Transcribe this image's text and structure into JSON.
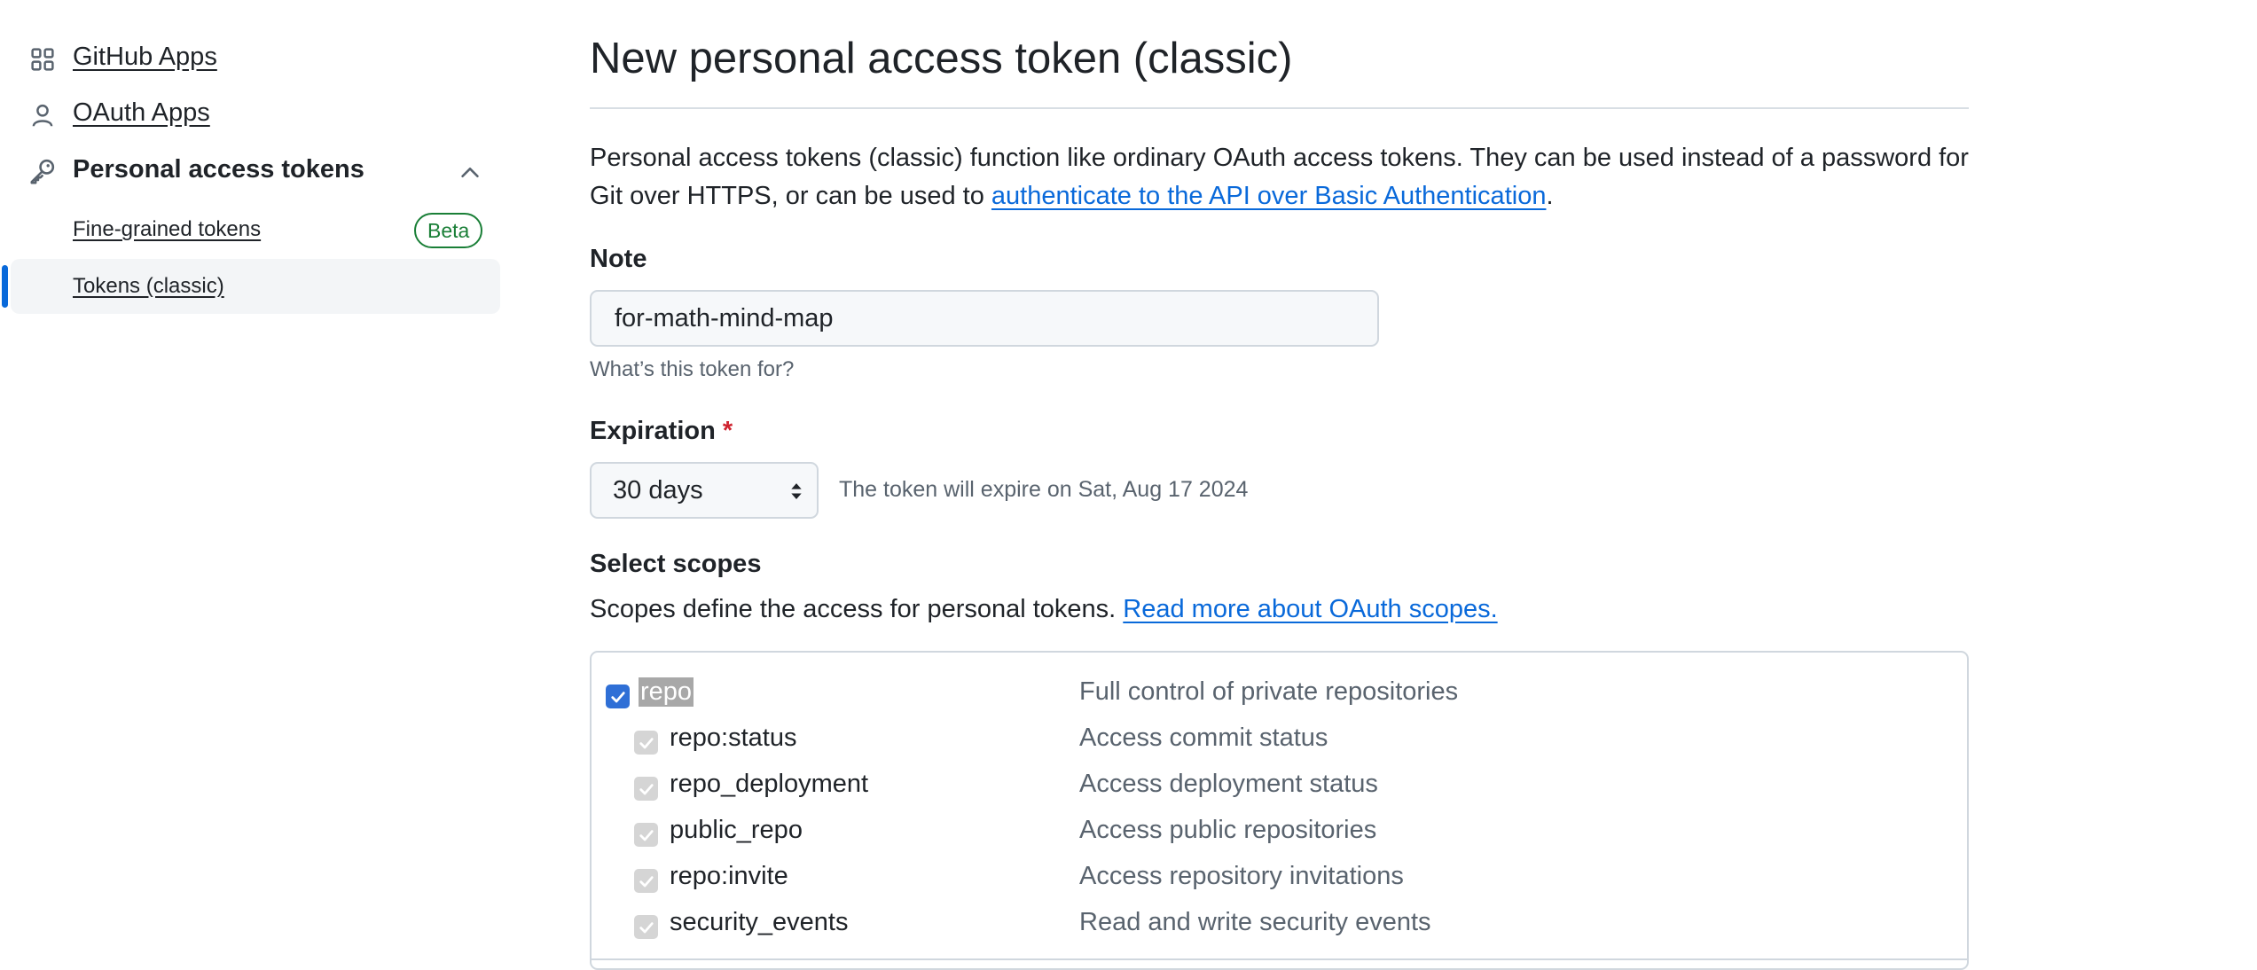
{
  "sidebar": {
    "github_apps": "GitHub Apps",
    "oauth_apps": "OAuth Apps",
    "personal_access_tokens": "Personal access tokens",
    "fine_grained_tokens": "Fine-grained tokens",
    "beta_badge": "Beta",
    "tokens_classic": "Tokens (classic)",
    "icons": [
      "apps-grid-icon",
      "person-icon",
      "key-icon",
      "chevron-up-icon"
    ]
  },
  "main": {
    "title": "New personal access token (classic)",
    "description_prefix": "Personal access tokens (classic) function like ordinary OAuth access tokens. They can be used instead of a password for Git over HTTPS, or can be used to ",
    "description_link": "authenticate to the API over Basic Authentication",
    "description_suffix": ".",
    "note": {
      "label": "Note",
      "value": "for-math-mind-map",
      "hint": "What’s this token for?"
    },
    "expiration": {
      "label": "Expiration",
      "required_mark": "*",
      "selected": "30 days",
      "expire_text": "The token will expire on Sat, Aug 17 2024"
    },
    "scopes": {
      "label": "Select scopes",
      "description": "Scopes define the access for personal tokens. ",
      "link": "Read more about OAuth scopes.",
      "items": [
        {
          "name": "repo",
          "desc": "Full control of private repositories"
        },
        {
          "name": "repo:status",
          "desc": "Access commit status"
        },
        {
          "name": "repo_deployment",
          "desc": "Access deployment status"
        },
        {
          "name": "public_repo",
          "desc": "Access public repositories"
        },
        {
          "name": "repo:invite",
          "desc": "Access repository invitations"
        },
        {
          "name": "security_events",
          "desc": "Read and write security events"
        }
      ]
    }
  },
  "colors": {
    "accent": "#0969da",
    "success": "#1a7f37",
    "danger": "#cf222e",
    "checkbox_checked": "#2f6fd6"
  }
}
